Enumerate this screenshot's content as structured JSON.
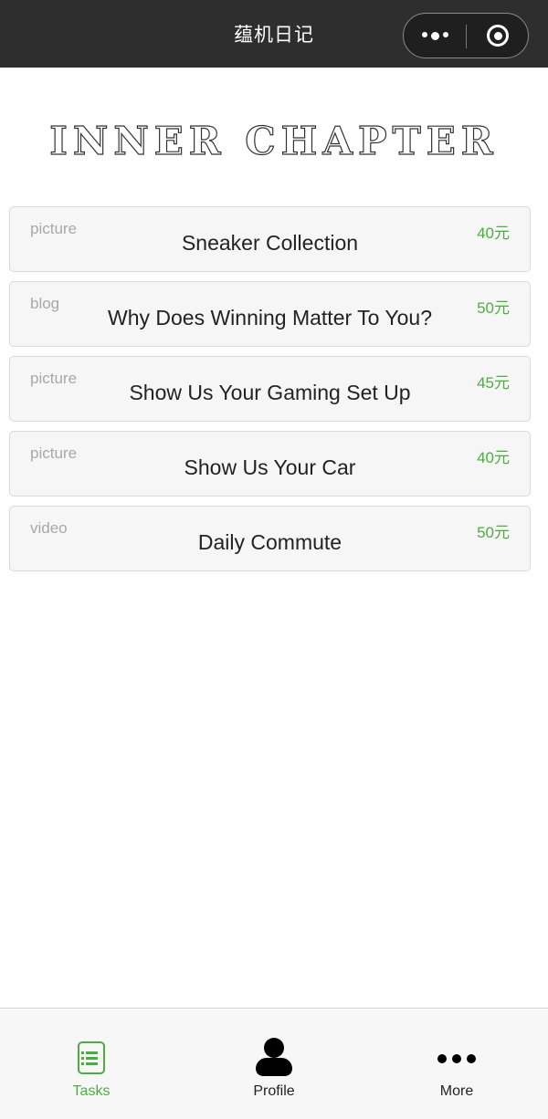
{
  "navbar": {
    "title": "蕴机日记"
  },
  "logo": {
    "text": "INNER CHAPTER"
  },
  "tasks": [
    {
      "type": "picture",
      "name": "Sneaker Collection",
      "price": "40元"
    },
    {
      "type": "blog",
      "name": "Why Does Winning Matter To You?",
      "price": "50元"
    },
    {
      "type": "picture",
      "name": "Show Us Your Gaming Set Up",
      "price": "45元"
    },
    {
      "type": "picture",
      "name": "Show Us Your Car",
      "price": "40元"
    },
    {
      "type": "video",
      "name": "Daily Commute",
      "price": "50元"
    }
  ],
  "tabbar": {
    "items": [
      {
        "label": "Tasks",
        "icon": "task-list-icon",
        "active": true
      },
      {
        "label": "Profile",
        "icon": "person-icon",
        "active": false
      },
      {
        "label": "More",
        "icon": "more-dots-icon",
        "active": false
      }
    ]
  },
  "colors": {
    "accent": "#4cae3f",
    "navbar": "#2e2e2e",
    "card_bg": "#f6f6f6"
  }
}
